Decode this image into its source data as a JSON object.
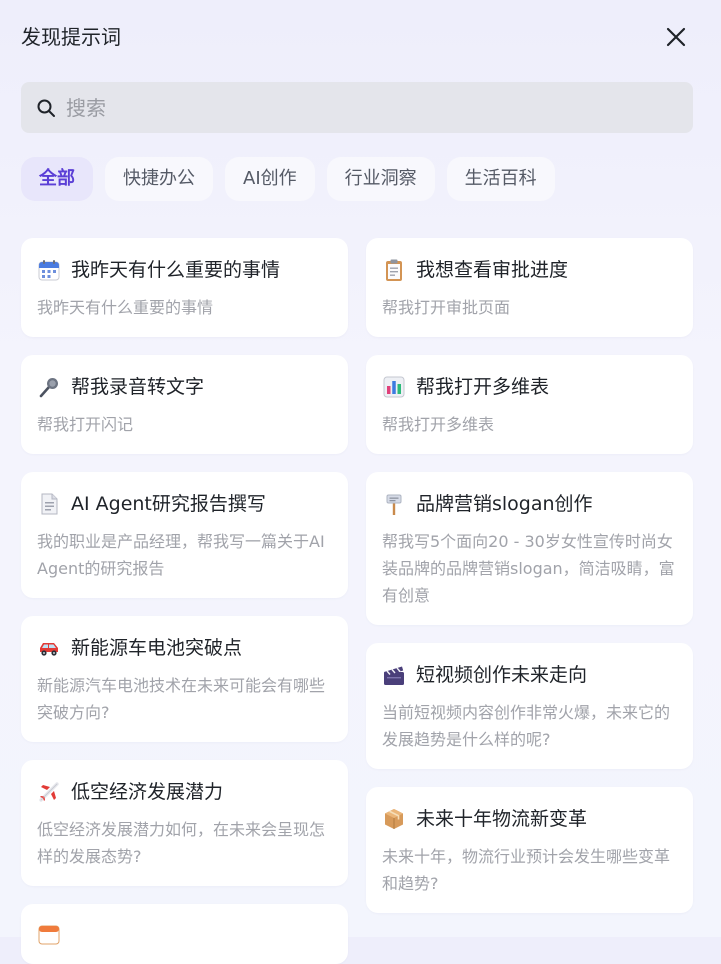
{
  "header": {
    "title": "发现提示词"
  },
  "search": {
    "placeholder": "搜索",
    "value": ""
  },
  "tabs": [
    {
      "label": "全部",
      "active": true
    },
    {
      "label": "快捷办公",
      "active": false
    },
    {
      "label": "AI创作",
      "active": false
    },
    {
      "label": "行业洞察",
      "active": false
    },
    {
      "label": "生活百科",
      "active": false
    }
  ],
  "cards_left": [
    {
      "icon": "calendar-icon",
      "title": "我昨天有什么重要的事情",
      "desc": "我昨天有什么重要的事情"
    },
    {
      "icon": "microphone-icon",
      "title": "帮我录音转文字",
      "desc": "帮我打开闪记"
    },
    {
      "icon": "document-icon",
      "title": "AI Agent研究报告撰写",
      "desc": "我的职业是产品经理，帮我写一篇关于AI Agent的研究报告"
    },
    {
      "icon": "car-icon",
      "title": "新能源车电池突破点",
      "desc": "新能源汽车电池技术在未来可能会有哪些突破方向?"
    },
    {
      "icon": "airplane-icon",
      "title": "低空经济发展潜力",
      "desc": "低空经济发展潜力如何，在未来会呈现怎样的发展态势?"
    }
  ],
  "cards_right": [
    {
      "icon": "clipboard-icon",
      "title": "我想查看审批进度",
      "desc": "帮我打开审批页面"
    },
    {
      "icon": "bar-chart-icon",
      "title": "帮我打开多维表",
      "desc": "帮我打开多维表"
    },
    {
      "icon": "signpost-icon",
      "title": "品牌营销slogan创作",
      "desc": "帮我写5个面向20 - 30岁女性宣传时尚女装品牌的品牌营销slogan，简洁吸睛，富有创意"
    },
    {
      "icon": "clapperboard-icon",
      "title": "短视频创作未来走向",
      "desc": "当前短视频内容创作非常火爆，未来它的发展趋势是什么样的呢?"
    },
    {
      "icon": "package-icon",
      "title": "未来十年物流新变革",
      "desc": "未来十年，物流行业预计会发生哪些变革和趋势?"
    }
  ],
  "colors": {
    "accent": "#5b3fd6",
    "active_tab_bg": "#e8e6fb",
    "search_bg": "#e4e5eb",
    "card_bg": "#ffffff",
    "desc_text": "#a1a3aa"
  }
}
